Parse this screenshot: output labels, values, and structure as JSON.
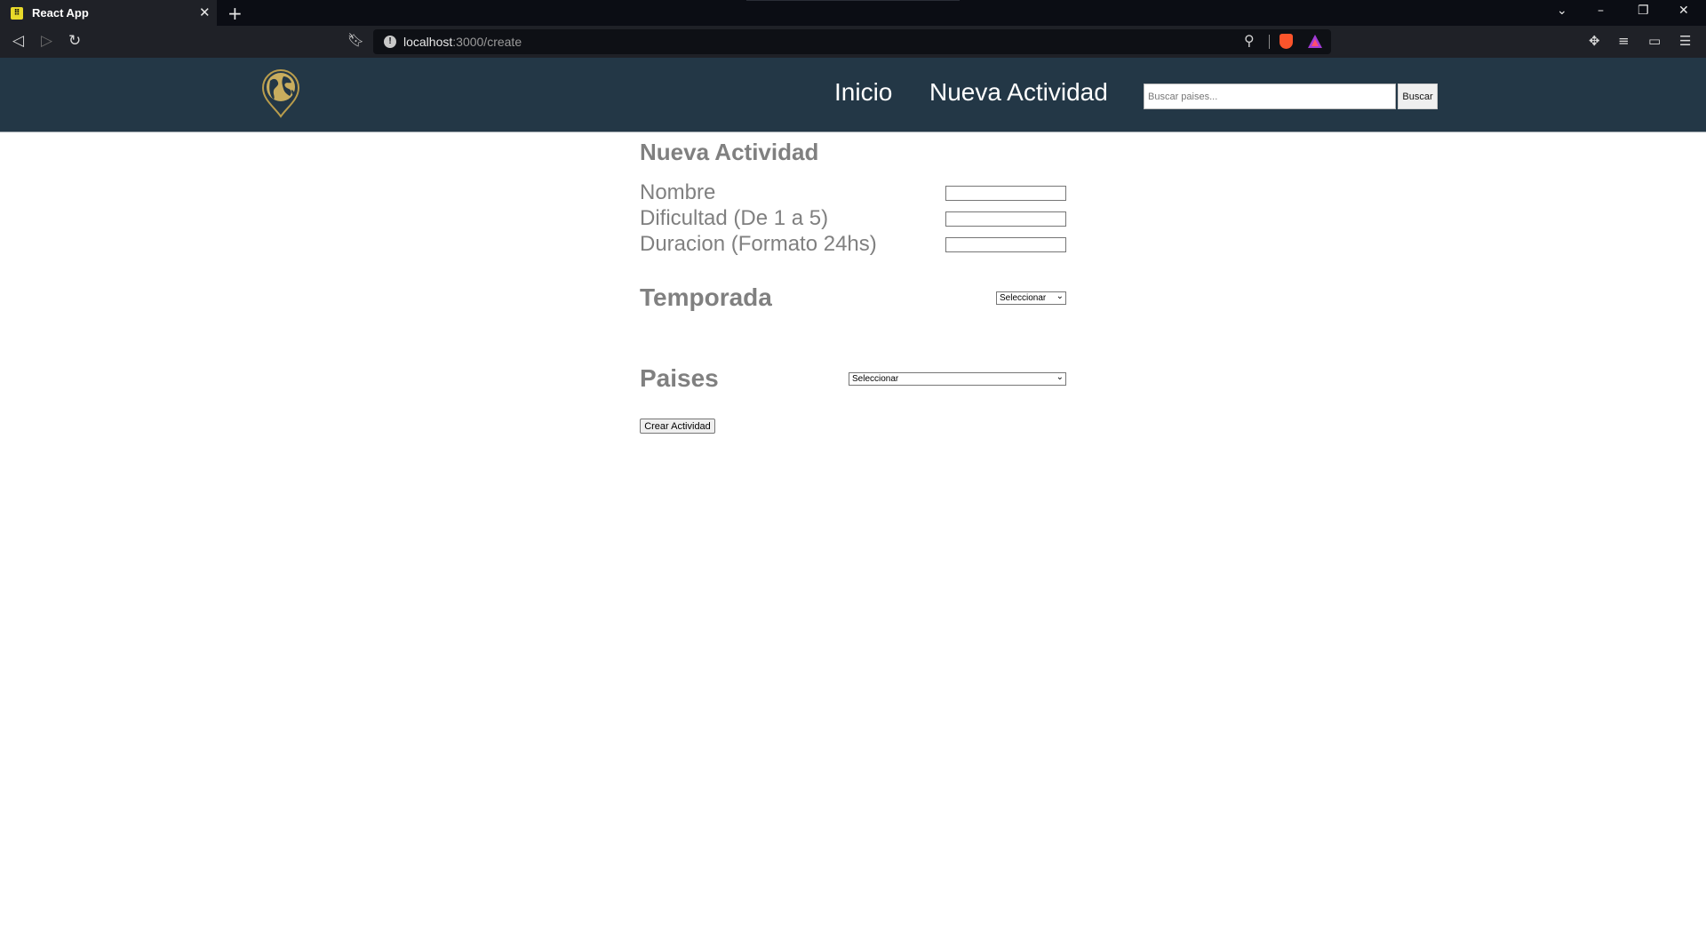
{
  "browser": {
    "tab_title": "React App",
    "tab_close": "✕",
    "new_tab": "+",
    "url_host": "localhost",
    "url_path": ":3000/create"
  },
  "header": {
    "logo": "globe-pin-logo",
    "nav": [
      {
        "label": "Inicio"
      },
      {
        "label": "Nueva Actividad"
      }
    ],
    "search": {
      "placeholder": "Buscar paises...",
      "value": "",
      "button_label": "Buscar"
    }
  },
  "form": {
    "title": "Nueva Actividad",
    "fields": [
      {
        "label": "Nombre",
        "value": ""
      },
      {
        "label": "Dificultad (De 1 a 5)",
        "value": ""
      },
      {
        "label": "Duracion (Formato 24hs)",
        "value": ""
      }
    ],
    "temporada": {
      "label": "Temporada",
      "selected": "Seleccionar"
    },
    "paises": {
      "label": "Paises",
      "selected": "Seleccionar"
    },
    "submit_label": "Crear Actividad"
  },
  "colors": {
    "header_bg": "#233746",
    "label_gray": "#808080",
    "logo_gold": "#b89c4c"
  }
}
